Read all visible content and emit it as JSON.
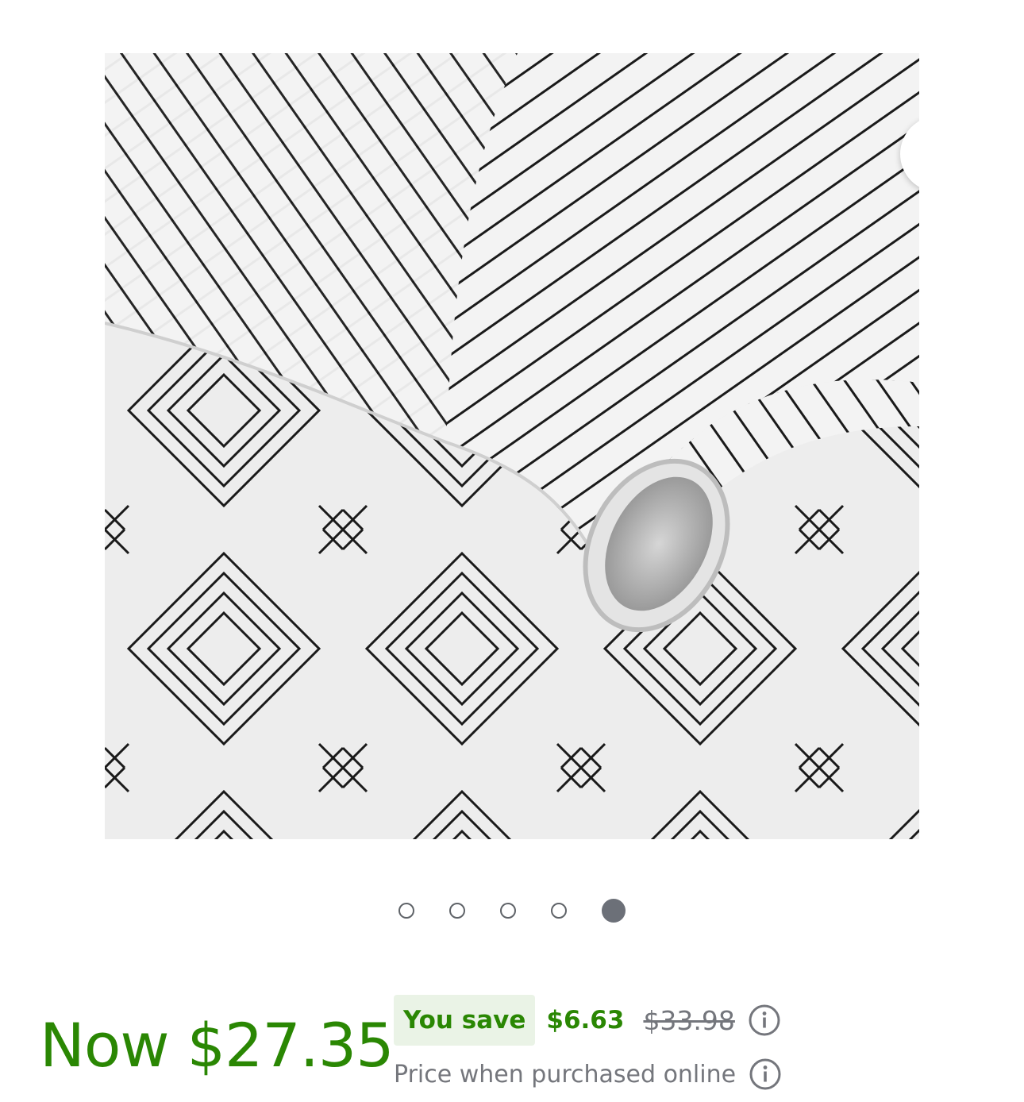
{
  "product": {
    "image_alt": "Black and white geometric diamond pattern peel and stick wallpaper roll",
    "favorite_icon": "heart-outline-icon"
  },
  "carousel": {
    "total": 5,
    "active_index": 4
  },
  "price": {
    "now_label": "Now $27.35",
    "you_save_label": "You save",
    "save_amount": "$6.63",
    "was_price": "$33.98",
    "note": "Price when purchased online",
    "info_icon": "info-circle-icon"
  },
  "colors": {
    "price_green": "#2a8703",
    "badge_bg": "#eaf3e6",
    "muted_gray": "#74767c",
    "dot_active": "#6c7078"
  }
}
